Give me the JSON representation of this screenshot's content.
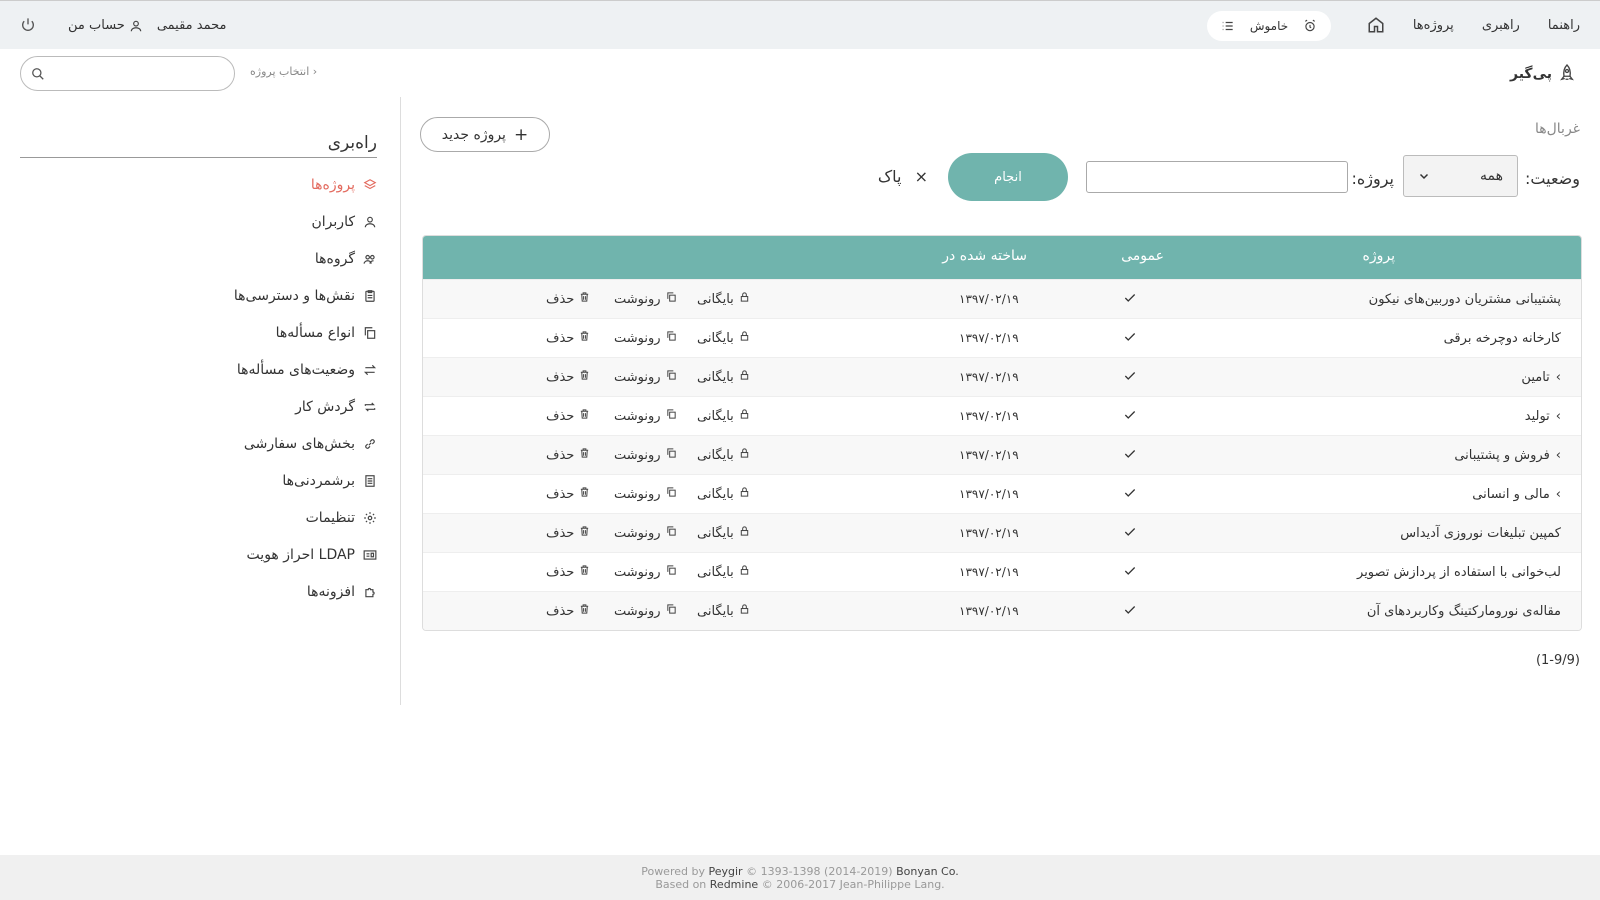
{
  "topbar": {
    "nav": [
      "پروژه‌ها",
      "راهبری",
      "راهنما"
    ],
    "mute_label": "خاموش",
    "user_name": "محمد مقیمی",
    "my_account": "حساب من"
  },
  "header": {
    "logo_text": "پی‌گیر",
    "choose_project": "انتخاب پروژه",
    "search_placeholder": ""
  },
  "sidebar": {
    "title": "راه‌بری",
    "items": [
      {
        "label": "پروژه‌ها",
        "icon": "layers-icon",
        "active": true
      },
      {
        "label": "کاربران",
        "icon": "user-icon"
      },
      {
        "label": "گروه‌ها",
        "icon": "users-icon"
      },
      {
        "label": "نقش‌ها و دسترسی‌ها",
        "icon": "clipboard-icon"
      },
      {
        "label": "انواع مسأله‌ها",
        "icon": "copy-icon"
      },
      {
        "label": "وضعیت‌های مسأله‌ها",
        "icon": "swap-icon"
      },
      {
        "label": "گردش کار",
        "icon": "repeat-icon"
      },
      {
        "label": "بخش‌های سفارشی",
        "icon": "link-icon"
      },
      {
        "label": "برشمردنی‌ها",
        "icon": "list-icon"
      },
      {
        "label": "تنظیمات",
        "icon": "gear-icon"
      },
      {
        "label": "احراز هویت LDAP",
        "icon": "id-card-icon"
      },
      {
        "label": "افزونه‌ها",
        "icon": "puzzle-icon"
      }
    ]
  },
  "main": {
    "filters_title": "غربال‌ها",
    "new_project": "پروژه جدید",
    "status_label": "وضعیت:",
    "status_value": "همه",
    "project_label": "پروژه:",
    "apply": "انجام",
    "clear": "پاک",
    "columns": {
      "project": "پروژه",
      "public": "عمومی",
      "created": "ساخته شده در"
    },
    "actions": {
      "archive": "بایگانی",
      "copy": "رونوشت",
      "delete": "حذف"
    },
    "rows": [
      {
        "name": "پشتیبانی مشتریان دوربین‌های نیکون",
        "date": "۱۳۹۷/۰۲/۱۹",
        "expandable": false
      },
      {
        "name": "کارخانه دوچرخه برقی",
        "date": "۱۳۹۷/۰۲/۱۹",
        "expandable": false
      },
      {
        "name": "تامین",
        "date": "۱۳۹۷/۰۲/۱۹",
        "expandable": true
      },
      {
        "name": "تولید",
        "date": "۱۳۹۷/۰۲/۱۹",
        "expandable": true
      },
      {
        "name": "فروش و پشتیبانی",
        "date": "۱۳۹۷/۰۲/۱۹",
        "expandable": true
      },
      {
        "name": "مالی و انسانی",
        "date": "۱۳۹۷/۰۲/۱۹",
        "expandable": true
      },
      {
        "name": "کمپین تبلیغات نوروزی آدیداس",
        "date": "۱۳۹۷/۰۲/۱۹",
        "expandable": false
      },
      {
        "name": "لب‌خوانی با استفاده از پردازش تصویر",
        "date": "۱۳۹۷/۰۲/۱۹",
        "expandable": false
      },
      {
        "name": "مقاله‌ی نورومارکتینگ وکاربردهای آن",
        "date": "۱۳۹۷/۰۲/۱۹",
        "expandable": false
      }
    ],
    "pager": "(1-9/9)"
  },
  "footer": {
    "powered_by": "Powered by",
    "peygir": "Peygir",
    "copy1": "© 1393-1398 (2014-2019)",
    "bonyan": "Bonyan Co.",
    "based_on": "Based on",
    "redmine": "Redmine",
    "copy2": "© 2006-2017 Jean-Philippe Lang."
  },
  "colors": {
    "accent": "#70b4ad",
    "active": "#e36b5f",
    "topbar": "#eef1f3"
  }
}
